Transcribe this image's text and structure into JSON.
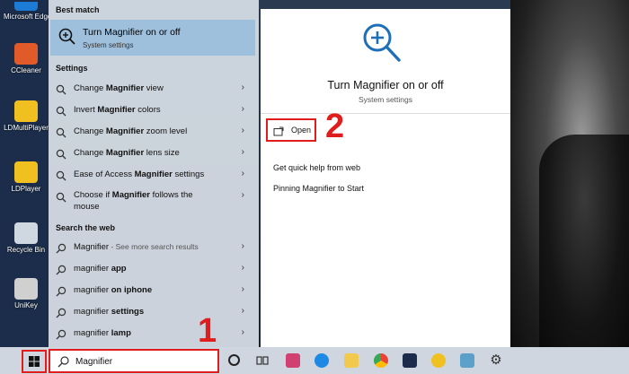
{
  "desktop": {
    "icons": [
      {
        "label": "Microsoft Edge",
        "color": "#1c7bd4"
      },
      {
        "label": "CCleaner",
        "color": "#e05a2a"
      },
      {
        "label": "LDMultiPlayer",
        "color": "#f0c020"
      },
      {
        "label": "LDPlayer",
        "color": "#f0c020"
      },
      {
        "label": "Recycle Bin",
        "color": "#cfd8e0"
      },
      {
        "label": "UniKey",
        "color": "#d0d0d0"
      }
    ]
  },
  "left_pane": {
    "best_match_header": "Best match",
    "best_match": {
      "title": "Turn Magnifier on or off",
      "subtitle": "System settings",
      "icon": "magnifier-plus-icon"
    },
    "settings_header": "Settings",
    "settings_items": [
      {
        "pre": "Change ",
        "bold": "Magnifier",
        "post": " view"
      },
      {
        "pre": "Invert ",
        "bold": "Magnifier",
        "post": " colors"
      },
      {
        "pre": "Change ",
        "bold": "Magnifier",
        "post": " zoom level"
      },
      {
        "pre": "Change ",
        "bold": "Magnifier",
        "post": " lens size"
      },
      {
        "pre": "Ease of Access ",
        "bold": "Magnifier",
        "post": " settings"
      },
      {
        "pre": "Choose if ",
        "bold": "Magnifier",
        "post": " follows the",
        "line2": "mouse"
      }
    ],
    "web_header": "Search the web",
    "web_items": [
      {
        "pre": "Magnifier",
        "bold": "",
        "post": "",
        "muted": " - See more search results"
      },
      {
        "pre": "magnifier ",
        "bold": "app",
        "post": ""
      },
      {
        "pre": "magnifier ",
        "bold": "on iphone",
        "post": ""
      },
      {
        "pre": "magnifier ",
        "bold": "settings",
        "post": ""
      },
      {
        "pre": "magnifier ",
        "bold": "lamp",
        "post": ""
      }
    ]
  },
  "right_pane": {
    "title": "Turn Magnifier on or off",
    "subtitle": "System settings",
    "open_label": "Open",
    "help_header": "Get quick help from web",
    "help_link": "Pinning Magnifier to Start"
  },
  "annotations": {
    "step1": "1",
    "step2": "2",
    "color": "#e01c1c"
  },
  "taskbar": {
    "search_value": "Magnifier",
    "apps": [
      {
        "name": "cortana-icon",
        "color": "#222222"
      },
      {
        "name": "task-view-icon",
        "color": "#333333"
      },
      {
        "name": "app-icon-1",
        "color": "#d04070"
      },
      {
        "name": "zalo-icon",
        "color": "#1e88e5"
      },
      {
        "name": "file-explorer-icon",
        "color": "#f2c94c"
      },
      {
        "name": "chrome-icon",
        "color": "#34a853"
      },
      {
        "name": "photoshop-icon",
        "color": "#1a2b4c"
      },
      {
        "name": "ldplayer-icon",
        "color": "#f0c020"
      },
      {
        "name": "app-icon-2",
        "color": "#5aa0c8"
      },
      {
        "name": "settings-icon",
        "color": "#333333"
      }
    ]
  }
}
